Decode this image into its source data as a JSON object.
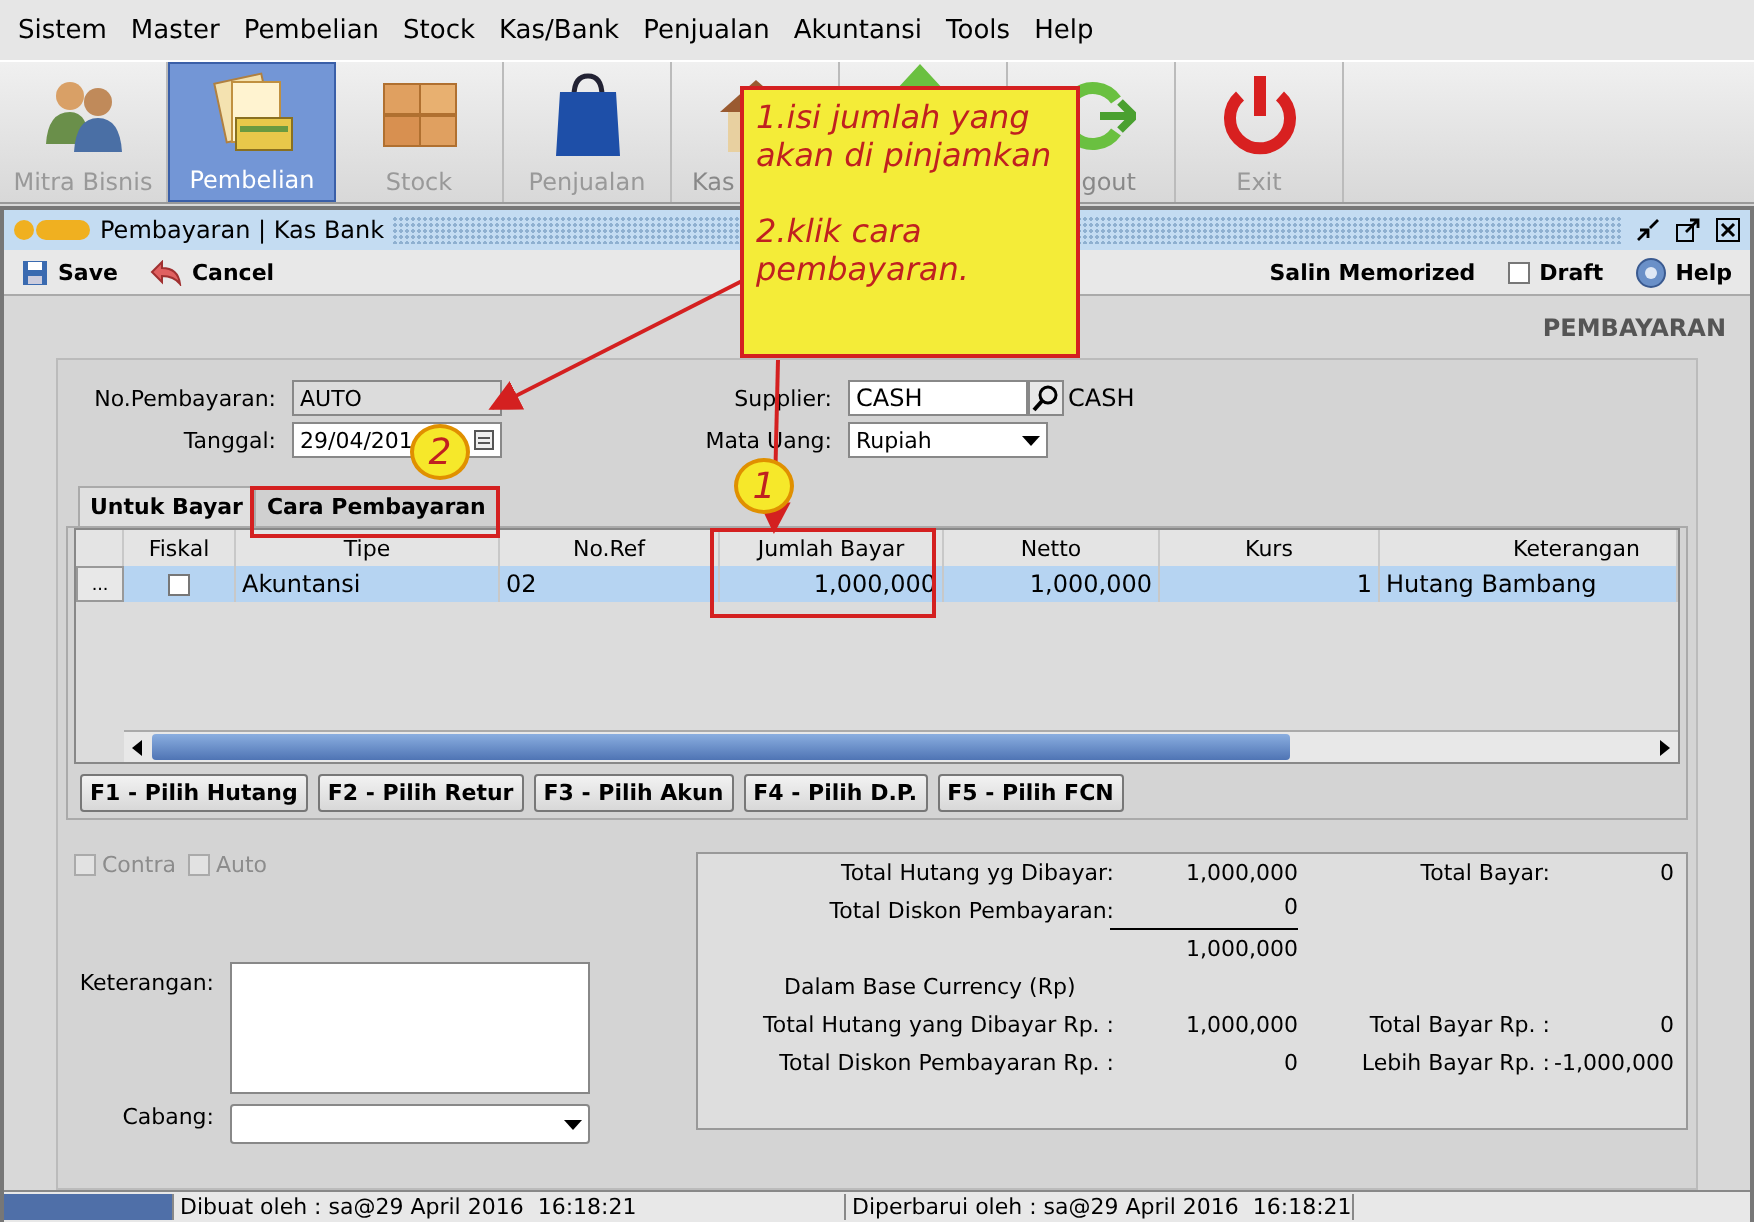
{
  "menu": [
    {
      "label": "Sistem"
    },
    {
      "label": "Master"
    },
    {
      "label": "Pembelian"
    },
    {
      "label": "Stock"
    },
    {
      "label": "Kas/Bank"
    },
    {
      "label": "Penjualan"
    },
    {
      "label": "Akuntansi"
    },
    {
      "label": "Tools"
    },
    {
      "label": "Help"
    }
  ],
  "toolbar": [
    {
      "label": "Mitra Bisnis",
      "kind": "people",
      "selected": false
    },
    {
      "label": "Pembelian",
      "kind": "documents",
      "selected": true
    },
    {
      "label": "Stock",
      "kind": "boxes",
      "selected": false
    },
    {
      "label": "Penjualan",
      "kind": "bag",
      "selected": false
    },
    {
      "label": "Kas",
      "kind": "house",
      "selected": false
    },
    {
      "kind": "arrow",
      "selected": false
    },
    {
      "label": "gout",
      "kind": "logout",
      "selected": false
    },
    {
      "label": "Exit",
      "kind": "power",
      "selected": false
    }
  ],
  "window": {
    "title": "Pembayaran | Kas Bank",
    "heading": "PEMBAYARAN"
  },
  "actions": [
    {
      "label": "Save",
      "kind": "save"
    },
    {
      "label": "Cancel",
      "kind": "cancel"
    }
  ],
  "right_actions": {
    "memorized": "Salin Memorized",
    "draft": {
      "label": "Draft",
      "checked": false
    },
    "help": "Help"
  },
  "form": {
    "no_label": "No.Pembayaran:",
    "no_value": "AUTO",
    "date_label": "Tanggal:",
    "date_value": "29/04/201",
    "supplier_label": "Supplier:",
    "supplier_value": "CASH",
    "supplier_name": "CASH",
    "currency_label": "Mata Uang:",
    "currency_value": "Rupiah"
  },
  "tabs": [
    {
      "label": "Untuk Bayar",
      "selected": true
    },
    {
      "label": "Cara Pembayaran",
      "selected": false
    }
  ],
  "table": {
    "columns": [
      "Fiskal",
      "Tipe",
      "No.Ref",
      "Jumlah Bayar",
      "Netto",
      "Kurs",
      "Keterangan"
    ],
    "rows": [
      {
        "row_button": "...",
        "fiskal": false,
        "tipe": "Akuntansi",
        "no_ref": "02",
        "jumlah": "1,000,000",
        "netto": "1,000,000",
        "kurs": "1",
        "keterangan": "Hutang Bambang",
        "selected": true
      }
    ]
  },
  "fkeys": [
    "F1 - Pilih Hutang",
    "F2 - Pilih Retur",
    "F3 - Pilih Akun",
    "F4 - Pilih D.P.",
    "F5 - Pilih FCN"
  ],
  "options": [
    {
      "label": "Contra",
      "checked": false,
      "disabled": true
    },
    {
      "label": "Auto",
      "checked": false,
      "disabled": true
    }
  ],
  "notes": {
    "label": "Keterangan:",
    "branch_label": "Cabang:"
  },
  "summary": [
    {
      "kind": "pair",
      "label": "Total Hutang yg Dibayar:",
      "value": "1,000,000",
      "label2": "Total Bayar:",
      "value2": "0"
    },
    {
      "kind": "underlined",
      "label": "Total Diskon Pembayaran:",
      "value": "0"
    },
    {
      "kind": "pair",
      "value": "1,000,000"
    },
    {
      "kind": "heading",
      "label": "Dalam Base Currency (Rp)"
    },
    {
      "kind": "pair",
      "label": "Total Hutang yang Dibayar Rp. :",
      "value": "1,000,000",
      "label2": "Total Bayar Rp. :",
      "value2": "0"
    },
    {
      "kind": "pair",
      "label": "Total Diskon Pembayaran Rp. :",
      "value": "0",
      "label2": "Lebih Bayar Rp. :",
      "value2": "-1,000,000"
    }
  ],
  "status_bar": {
    "created": "Dibuat oleh : sa@29 April 2016  16:18:21",
    "updated": "Diperbarui oleh : sa@29 April 2016  16:18:21"
  },
  "callout": {
    "paragraphs": [
      "1.isi jumlah yang akan di pinjamkan",
      "2.klik cara pembayaran."
    ]
  },
  "steps": [
    {
      "number": "1"
    },
    {
      "number": "2"
    }
  ]
}
